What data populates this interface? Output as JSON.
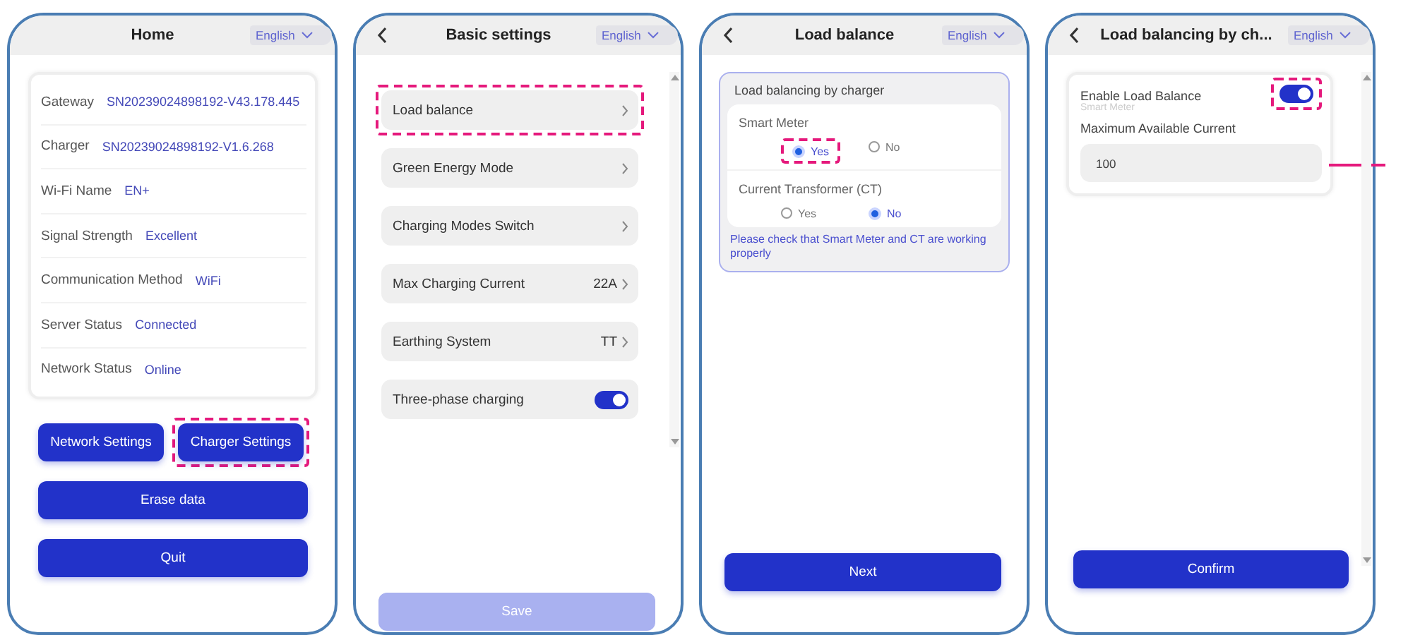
{
  "screens": [
    {
      "kind": "home",
      "title": "Home",
      "language": "English",
      "info_rows": [
        {
          "label": "Gateway",
          "value": "SN20239024898192-V43.178.445"
        },
        {
          "label": "Charger",
          "value": "SN20239024898192-V1.6.268"
        },
        {
          "label": "Wi-Fi Name",
          "value": "EN+"
        },
        {
          "label": "Signal Strength",
          "value": "Excellent"
        },
        {
          "label": "Communication Method",
          "value": "WiFi"
        },
        {
          "label": "Server Status",
          "value": "Connected"
        },
        {
          "label": "Network Status",
          "value": "Online"
        }
      ],
      "buttons": [
        {
          "label": "Network Settings",
          "kind": "half",
          "highlighted": false
        },
        {
          "label": "Charger Settings",
          "kind": "half",
          "highlighted": true
        },
        {
          "label": "Erase data",
          "kind": "full",
          "highlighted": false
        },
        {
          "label": "Quit",
          "kind": "full",
          "highlighted": false
        }
      ]
    },
    {
      "kind": "menu",
      "title": "Basic settings",
      "language": "English",
      "back_button": true,
      "rows": [
        {
          "label": "Load balance",
          "kind": "link",
          "highlighted": true
        },
        {
          "label": "Green Energy Mode",
          "kind": "link",
          "highlighted": false
        },
        {
          "label": "Charging Modes Switch",
          "kind": "link",
          "highlighted": false
        },
        {
          "label": "Max Charging Current",
          "kind": "link",
          "value": "22A",
          "highlighted": false
        },
        {
          "label": "Earthing System",
          "kind": "link",
          "value": "TT",
          "highlighted": false
        },
        {
          "label": "Three-phase charging",
          "kind": "switch",
          "on": true,
          "highlighted": false
        }
      ],
      "button": {
        "label": "Save",
        "disabled": true
      }
    },
    {
      "kind": "radio",
      "title": "Load balance",
      "language": "English",
      "back_button": true,
      "group_title": "Load balancing by charger",
      "questions": [
        {
          "label": "Smart Meter",
          "options": [
            {
              "label": "Yes",
              "selected": true,
              "highlighted": true
            },
            {
              "label": "No",
              "selected": false,
              "highlighted": false
            }
          ]
        },
        {
          "label": "Current Transformer (CT)",
          "options": [
            {
              "label": "Yes",
              "selected": false,
              "highlighted": false
            },
            {
              "label": "No",
              "selected": true,
              "highlighted": false
            }
          ]
        }
      ],
      "note": "Please check that Smart Meter and CT are working properly",
      "button": {
        "label": "Next",
        "disabled": false
      }
    },
    {
      "kind": "form",
      "title": "Load balancing by ch...",
      "language": "English",
      "back_button": true,
      "toggle": {
        "label": "Enable Load Balance",
        "sublabel": "Smart Meter",
        "on": true,
        "highlighted": true
      },
      "field": {
        "label": "Maximum Available Current",
        "value": "100",
        "leader_line": true
      },
      "button": {
        "label": "Confirm",
        "disabled": false
      }
    }
  ]
}
